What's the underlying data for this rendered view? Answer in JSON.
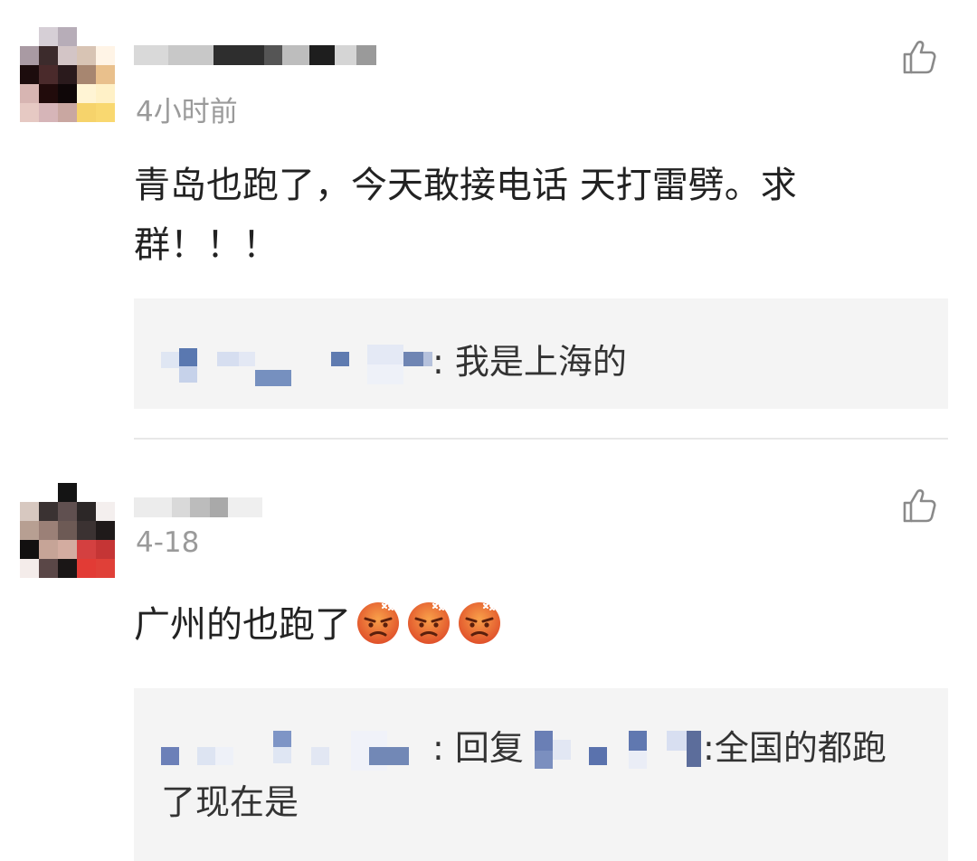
{
  "comments": [
    {
      "time": "4小时前",
      "text": "青岛也跑了，今天敢接电话 天打雷劈。求群！！！",
      "reply": {
        "sep": ": ",
        "text": "我是上海的"
      }
    },
    {
      "time": "4-18",
      "text": "广州的也跑了",
      "emoji_count": 3,
      "emoji_name": "angry-face-emoji",
      "reply": {
        "sep": ": ",
        "reply_word": "回复",
        "sep2": ":",
        "text": "全国的都跑了现在是"
      }
    }
  ],
  "icons": {
    "like": "thumbs-up-icon"
  },
  "colors": {
    "time": "#9a9a9a",
    "reply_bg": "#f4f4f4",
    "text": "#222222"
  }
}
